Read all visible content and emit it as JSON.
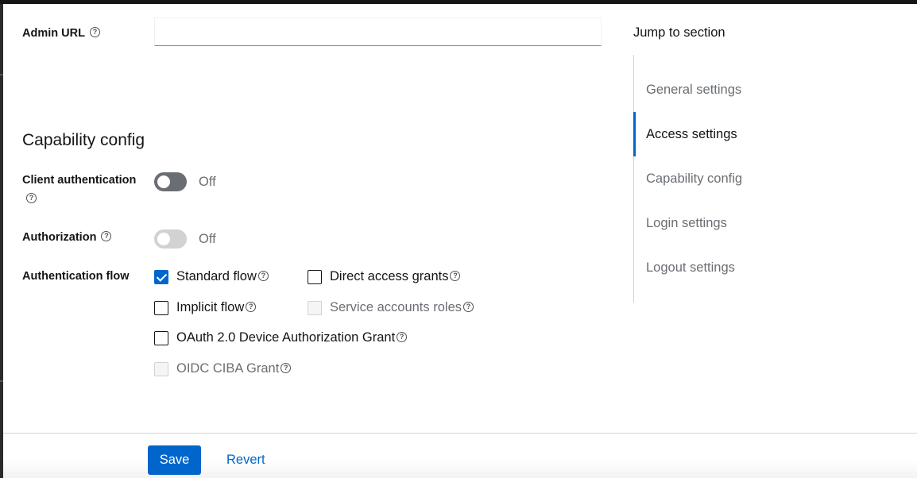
{
  "admin_url": {
    "label": "Admin URL",
    "value": "",
    "placeholder": ""
  },
  "capability": {
    "title": "Capability config",
    "client_authentication": {
      "label": "Client authentication",
      "state_text": "Off"
    },
    "authorization": {
      "label": "Authorization",
      "state_text": "Off"
    },
    "authentication_flow": {
      "label": "Authentication flow",
      "options": [
        {
          "label": "Standard flow",
          "checked": true,
          "disabled": false
        },
        {
          "label": "Direct access grants",
          "checked": false,
          "disabled": false
        },
        {
          "label": "Implicit flow",
          "checked": false,
          "disabled": false
        },
        {
          "label": "Service accounts roles",
          "checked": false,
          "disabled": true
        },
        {
          "label": "OAuth 2.0 Device Authorization Grant",
          "checked": false,
          "disabled": false
        },
        {
          "label": "OIDC CIBA Grant",
          "checked": false,
          "disabled": true
        }
      ]
    }
  },
  "jump": {
    "title": "Jump to section",
    "items": [
      {
        "label": "General settings"
      },
      {
        "label": "Access settings"
      },
      {
        "label": "Capability config"
      },
      {
        "label": "Login settings"
      },
      {
        "label": "Logout settings"
      }
    ],
    "active_index": 1
  },
  "footer": {
    "save_label": "Save",
    "revert_label": "Revert"
  },
  "icons": {
    "help": "?"
  },
  "colors": {
    "primary": "#0066cc",
    "muted": "#6a6e73",
    "text": "#151515"
  }
}
